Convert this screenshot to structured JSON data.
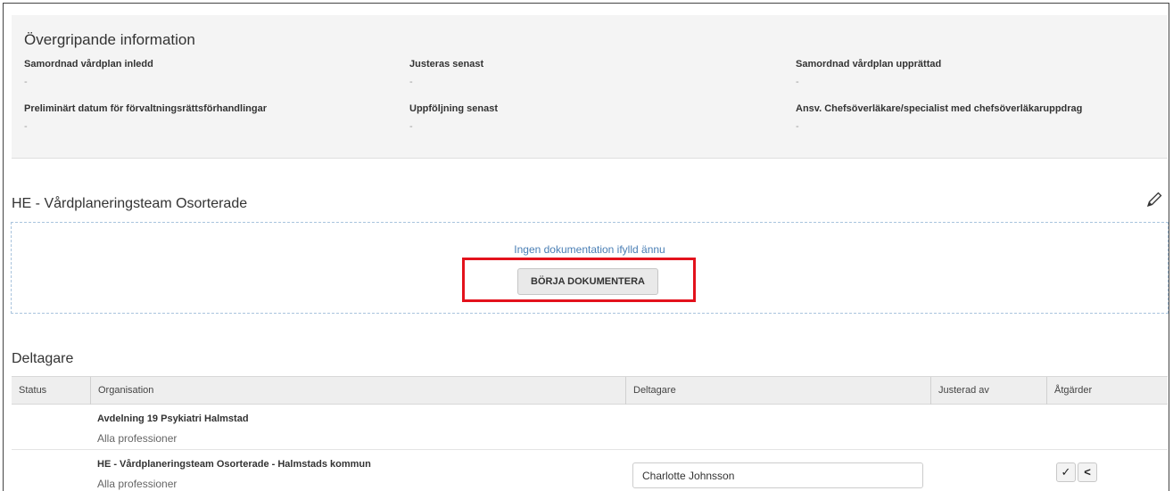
{
  "overview": {
    "title": "Övergripande information",
    "fields": [
      {
        "label": "Samordnad vårdplan inledd",
        "value": "-"
      },
      {
        "label": "Justeras senast",
        "value": "-"
      },
      {
        "label": "Samordnad vårdplan upprättad",
        "value": "-"
      },
      {
        "label": "Preliminärt datum för förvaltningsrättsförhandlingar",
        "value": "-"
      },
      {
        "label": "Uppföljning senast",
        "value": "-"
      },
      {
        "label": "Ansv. Chefsöverläkare/specialist med chefsöverläkaruppdrag",
        "value": "-"
      }
    ]
  },
  "team": {
    "title": "HE - Vårdplaneringsteam Osorterade",
    "edit_icon": "pencil-icon",
    "empty_text": "Ingen dokumentation ifylld ännu",
    "start_button": "BÖRJA DOKUMENTERA",
    "highlight_color": "#e3121c"
  },
  "participants": {
    "title": "Deltagare",
    "columns": [
      "Status",
      "Organisation",
      "Deltagare",
      "Justerad av",
      "Åtgärder"
    ],
    "rows": [
      {
        "status": "",
        "organisation": "Avdelning 19 Psykiatri Halmstad",
        "profession": "Alla professioner",
        "participant": "",
        "adjusted_by": ""
      },
      {
        "status": "",
        "organisation": "HE - Vårdplaneringsteam Osorterade - Halmstads kommun",
        "profession": "Alla professioner",
        "participant": "Charlotte Johnsson",
        "adjusted_by": "",
        "actions": {
          "approve": "✓",
          "share": "<"
        }
      }
    ]
  }
}
